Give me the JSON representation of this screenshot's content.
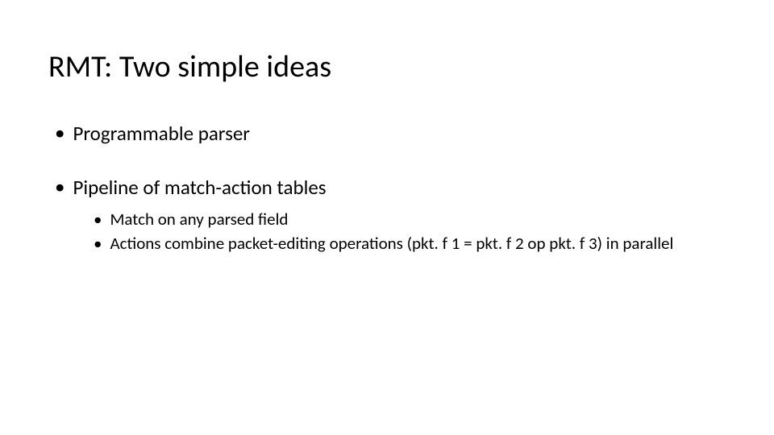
{
  "title": "RMT: Two simple ideas",
  "bullets": [
    {
      "text": "Programmable parser"
    },
    {
      "text": "Pipeline of match-action tables",
      "sub": [
        "Match on any parsed field",
        "Actions combine packet-editing operations (pkt. f 1 = pkt. f 2 op pkt. f 3) in parallel"
      ]
    }
  ]
}
